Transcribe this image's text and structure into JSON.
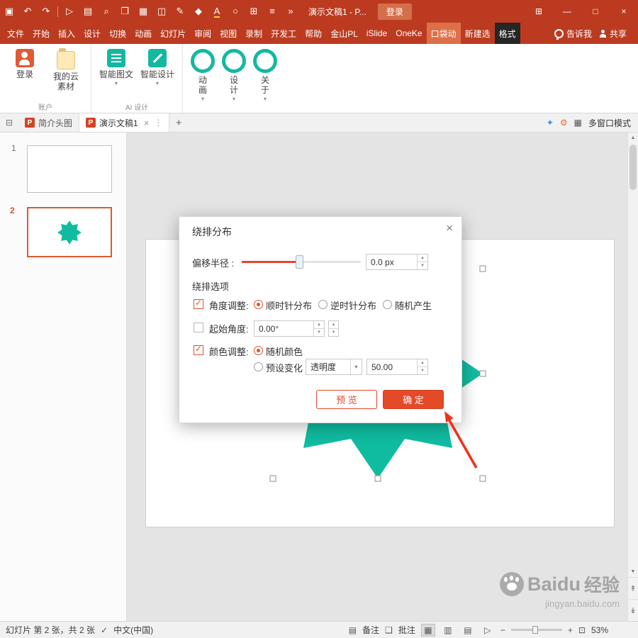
{
  "ui": {
    "caret": "▾",
    "up": "▲",
    "down": "▼"
  },
  "colors": {
    "titlebar": "#BC3B20",
    "accent": "#E44A27",
    "teal": "#12BCA2",
    "tab_selected": "#DE7049"
  },
  "titlebar": {
    "qat": [
      "▣",
      "↶",
      "↷",
      "▷",
      "▤",
      "⌕",
      "❐",
      "▦",
      "◫",
      "✎",
      "◆",
      "A",
      "○",
      "⊞",
      "≡",
      "»"
    ],
    "title": "演示文稿1 - P...",
    "login": "登录",
    "layout_icon": "⊞",
    "min": "—",
    "max": "□",
    "close": "×"
  },
  "tabs": {
    "items": [
      "文件",
      "开始",
      "插入",
      "设计",
      "切换",
      "动画",
      "幻灯片",
      "审阅",
      "视图",
      "录制",
      "开发工",
      "帮助",
      "金山PL",
      "iSlide",
      "OneKe",
      "口袋动",
      "新建选",
      "格式"
    ],
    "tell": "告诉我",
    "share": "共享"
  },
  "ribbon": {
    "login": "登录",
    "cloud": "我的云素材",
    "group1": "账户",
    "ai_doc": "智能图文",
    "ai_design": "智能设计",
    "group2": "AI 设计",
    "anim": "动画",
    "design": "设计",
    "about": "关于"
  },
  "doctabs": {
    "panel_icon": "⊟",
    "p": "P",
    "tab1": "简介头图",
    "tab2": "演示文稿1",
    "close": "×",
    "menu": "⋮",
    "add": "+",
    "wand": "✦",
    "gear": "⚙",
    "grid": "▦",
    "multi": "多窗口模式"
  },
  "slides": {
    "n1": "1",
    "n2": "2"
  },
  "dialog": {
    "title": "绕排分布",
    "close": "×",
    "offset_label": "偏移半径 :",
    "offset_value": "0.0 px",
    "section": "绕排选项",
    "angle_label": "角度调整:",
    "angle_opt1": "顺时针分布",
    "angle_opt2": "逆时针分布",
    "angle_opt3": "随机产生",
    "start_label": "起始角度:",
    "start_value": "0.00°",
    "color_label": "颜色调整:",
    "color_opt1": "随机颜色",
    "color_opt2": "预设变化",
    "preset_name": "透明度",
    "preset_value": "50.00",
    "preview": "预 览",
    "ok": "确 定"
  },
  "statusbar": {
    "slide_info": "幻灯片 第 2 张，共 2 张",
    "spell": "✓",
    "lang": "中文(中国)",
    "notes_icon": "▤",
    "notes": "备注",
    "comments_icon": "❑",
    "comments": "批注",
    "views": [
      "▦",
      "▥",
      "▤",
      "▷"
    ],
    "zoom_out": "−",
    "zoom_in": "+",
    "fit": "⊡",
    "zoom": "53%"
  },
  "scroll": {
    "up": "▲",
    "down": "▼",
    "prev": "↟",
    "next": "↡"
  },
  "watermark": {
    "brand": "Baidu",
    "word": "经验",
    "url": "jingyan.baidu.com"
  }
}
